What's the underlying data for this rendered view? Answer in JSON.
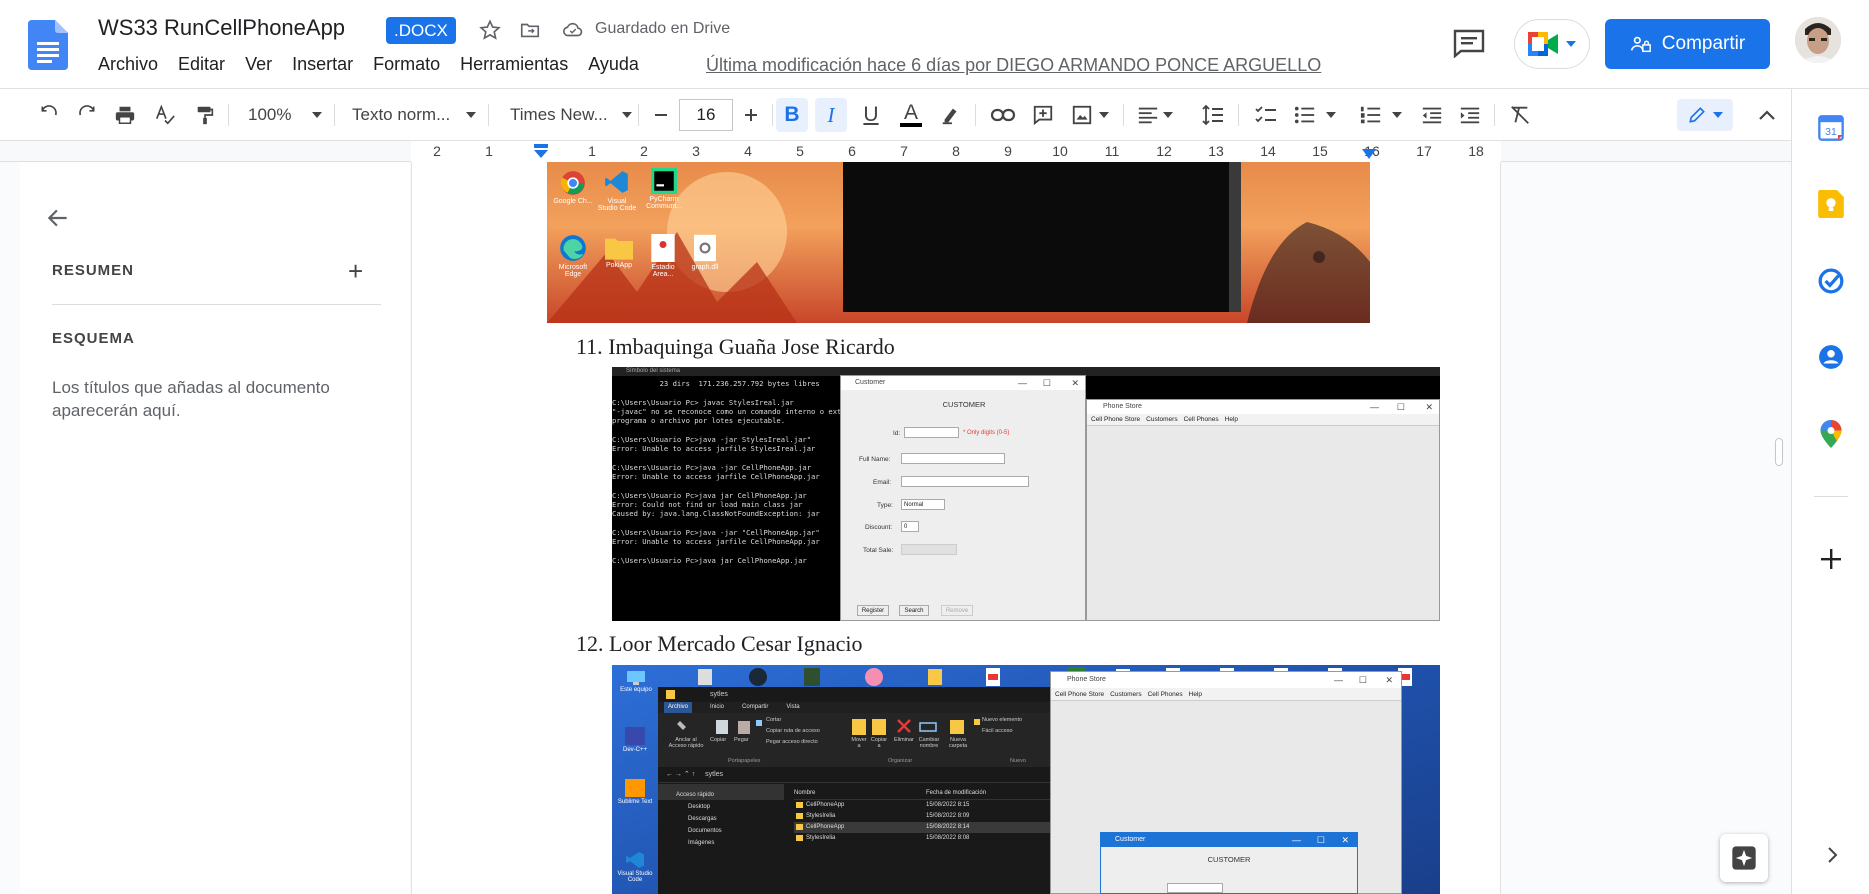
{
  "document": {
    "title": "WS33 RunCellPhoneApp",
    "badge": ".DOCX",
    "saved_status": "Guardado en Drive",
    "last_modified": "Última modificación hace 6 días por DIEGO ARMANDO PONCE ARGUELLO"
  },
  "menu": {
    "items": [
      "Archivo",
      "Editar",
      "Ver",
      "Insertar",
      "Formato",
      "Herramientas",
      "Ayuda"
    ]
  },
  "share": {
    "label": "Compartir"
  },
  "toolbar": {
    "zoom": "100%",
    "style": "Texto norm...",
    "font": "Times New...",
    "font_size": "16",
    "bold_label": "B",
    "italic_label": "I",
    "underline_label": "U",
    "text_color_label": "A"
  },
  "ruler": {
    "numbers": [
      "2",
      "1",
      "1",
      "2",
      "3",
      "4",
      "5",
      "6",
      "7",
      "8",
      "9",
      "10",
      "11",
      "12",
      "13",
      "14",
      "15",
      "16",
      "17",
      "18"
    ]
  },
  "outline": {
    "summary": "RESUMEN",
    "schema": "ESQUEMA",
    "hint": "Los títulos que añadas al documento aparecerán aquí."
  },
  "content": {
    "items": [
      {
        "number": "11.",
        "text": "Imbaquinga Guaña Jose Ricardo"
      },
      {
        "number": "12.",
        "text": "Loor Mercado Cesar Ignacio"
      }
    ],
    "screens": {
      "desktop_icons_1": [
        "Google Ch...",
        "Visual Studio Code",
        "PyCharm Communi...",
        "Microsoft Edge",
        "PokiApp",
        "Estadio Area...",
        "graph.dll"
      ],
      "cmd": {
        "title": "Símbolo del sistema",
        "lines": [
          "           23 dirs  171.236.257.792 bytes libres",
          "",
          "C:\\Users\\Usuario Pc> javac StylesIreal.jar",
          "\"-javac\" no se reconoce como un comando interno o ext",
          "programa o archivo por lotes ejecutable.",
          "",
          "C:\\Users\\Usuario Pc>java -jar StylesIreal.jar\"",
          "Error: Unable to access jarfile StylesIreal.jar",
          "",
          "C:\\Users\\Usuario Pc>java -jar CellPhoneApp.jar",
          "Error: Unable to access jarfile CellPhoneApp.jar",
          "",
          "C:\\Users\\Usuario Pc>java jar CellPhoneApp.jar",
          "Error: Could not find or load main class jar",
          "Caused by: java.lang.ClassNotFoundException: jar",
          "",
          "C:\\Users\\Usuario Pc>java -jar \"CellPhoneApp.jar\"",
          "Error: Unable to access jarfile CellPhoneApp.jar",
          "",
          "C:\\Users\\Usuario Pc>java jar CellPhoneApp.jar"
        ]
      },
      "customer": {
        "title": "Customer",
        "heading": "CUSTOMER",
        "id_label": "Id:",
        "id_hint": "* Only digits (0-5)",
        "fullname_label": "Full Name:",
        "email_label": "Email:",
        "type_label": "Type:",
        "type_value": "Normal",
        "discount_label": "Discount:",
        "discount_value": "0",
        "total_label": "Total Sale:",
        "btn1": "Register",
        "btn2": "Search",
        "btn3": "Remove"
      },
      "phonestore": {
        "title": "Phone Store",
        "menu": [
          "Cell Phone Store",
          "Customers",
          "Cell Phones",
          "Help"
        ]
      },
      "explorer": {
        "path": "sytles",
        "tabs": [
          "Archivo",
          "Inicio",
          "Compartir",
          "Vista"
        ],
        "ribbon": [
          "Anclar al Acceso rápido",
          "Copiar",
          "Pegar",
          "Cortar",
          "Copiar ruta de acceso",
          "Pegar acceso directo",
          "Mover a",
          "Copiar a",
          "Eliminar",
          "Cambiar nombre",
          "Nueva carpeta",
          "Nuevo elemento",
          "Fácil acceso"
        ],
        "groups": [
          "Portapapeles",
          "Organizar",
          "Nuevo"
        ],
        "nav": [
          "Acceso rápido",
          "Desktop",
          "Descargas",
          "Documentos",
          "Imágenes"
        ],
        "columns": [
          "Nombre",
          "Fecha de modificación"
        ],
        "files": [
          {
            "name": "CellPhoneApp",
            "date": "15/08/2022 8:15"
          },
          {
            "name": "StylesIrelia",
            "date": "15/08/2022 8:09"
          },
          {
            "name": "CellPhoneApp",
            "date": "15/08/2022 8:14"
          },
          {
            "name": "StylesIrelia",
            "date": "15/08/2022 8:08"
          }
        ]
      },
      "desktop_icons_2": [
        "Este equipo",
        "Dev-C++",
        "Sublime Text",
        "Visual Studio Code"
      ],
      "phonestore2": {
        "title": "Phone Store",
        "menu": [
          "Cell Phone Store",
          "Customers",
          "Cell Phones",
          "Help"
        ]
      },
      "customer2": {
        "title": "Customer",
        "heading": "CUSTOMER"
      }
    }
  },
  "colors": {
    "accent": "#1a73e8",
    "page_bg": "#f9fbfd"
  }
}
